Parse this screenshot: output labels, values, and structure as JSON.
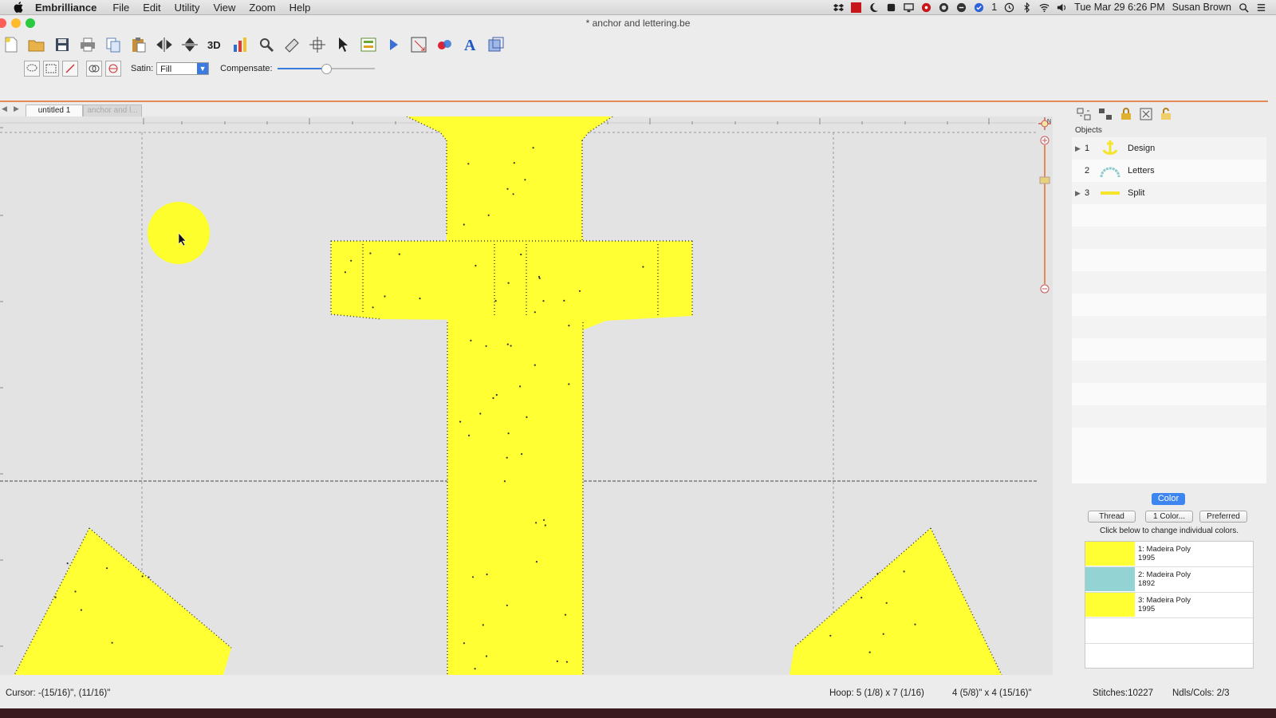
{
  "menubar": {
    "apple_icon": "apple-icon",
    "app_name": "Embrilliance",
    "menus": [
      "File",
      "Edit",
      "Utility",
      "View",
      "Zoom",
      "Help"
    ],
    "notification_count": "1",
    "clock": "Tue Mar 29  6:26 PM",
    "user": "Susan Brown"
  },
  "window": {
    "title": "* anchor and lettering.be"
  },
  "toolbar2": {
    "satin_label": "Satin:",
    "satin_value": "Fill",
    "compensate_label": "Compensate:",
    "compensate_level": 0.5
  },
  "tabs": [
    {
      "label": "untitled 1",
      "active": true
    },
    {
      "label": "anchor and l...",
      "active": false
    }
  ],
  "canvas": {
    "ruler_marker": "0in",
    "zoom_marker": "N",
    "fill_color": "#ffff33",
    "background": "#e3e3e3"
  },
  "objects": {
    "header": "Objects",
    "items": [
      {
        "num": "1",
        "name": "Design",
        "expandable": true
      },
      {
        "num": "2",
        "name": "Letters",
        "expandable": false
      },
      {
        "num": "3",
        "name": "Split",
        "expandable": true
      }
    ]
  },
  "color_panel": {
    "tab": "Color",
    "thread_button": "Thread",
    "one_color_button": "1 Color...",
    "preferred_button": "Preferred",
    "hint": "Click below to change individual colors.",
    "threads": [
      {
        "line1": "1: Madeira Poly",
        "line2": "1995",
        "color": "#ffff33"
      },
      {
        "line1": "2: Madeira Poly",
        "line2": "1892",
        "color": "#93d3d3"
      },
      {
        "line1": "3: Madeira Poly",
        "line2": "1995",
        "color": "#ffff33"
      }
    ]
  },
  "statusbar": {
    "cursor": "Cursor: -(15/16)\", (11/16)\"",
    "hoop": "Hoop: 5 (1/8) x 7 (1/16)",
    "size": "4 (5/8)\" x 4 (15/16)\"",
    "stitches": "Stitches:10227",
    "ndls": "Ndls/Cols: 2/3"
  }
}
